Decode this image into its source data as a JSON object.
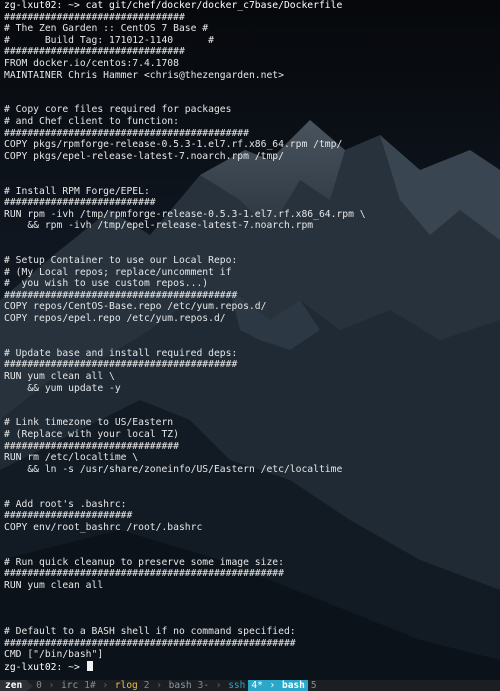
{
  "terminal": {
    "lines": [
      "zg-lxut02: ~> cat git/chef/docker/docker_c7base/Dockerfile",
      "###############################",
      "# The Zen Garden :: CentOS 7 Base #",
      "#      Build Tag: 171012-1140      #",
      "###############################",
      "FROM docker.io/centos:7.4.1708",
      "MAINTAINER Chris Hammer <chris@thezengarden.net>",
      "",
      "",
      "# Copy core files required for packages",
      "# and Chef client to function:",
      "##########################################",
      "COPY pkgs/rpmforge-release-0.5.3-1.el7.rf.x86_64.rpm /tmp/",
      "COPY pkgs/epel-release-latest-7.noarch.rpm /tmp/",
      "",
      "",
      "# Install RPM Forge/EPEL:",
      "##########################",
      "RUN rpm -ivh /tmp/rpmforge-release-0.5.3-1.el7.rf.x86_64.rpm \\",
      "    && rpm -ivh /tmp/epel-release-latest-7.noarch.rpm",
      "",
      "",
      "# Setup Container to use our Local Repo:",
      "# (My Local repos; replace/uncomment if",
      "#  you wish to use custom repos...)",
      "########################################",
      "COPY repos/CentOS-Base.repo /etc/yum.repos.d/",
      "COPY repos/epel.repo /etc/yum.repos.d/",
      "",
      "",
      "# Update base and install required deps:",
      "########################################",
      "RUN yum clean all \\",
      "    && yum update -y",
      "",
      "",
      "# Link timezone to US/Eastern",
      "# (Replace with your local TZ)",
      "##############################",
      "RUN rm /etc/localtime \\",
      "    && ln -s /usr/share/zoneinfo/US/Eastern /etc/localtime",
      "",
      "",
      "# Add root's .bashrc:",
      "######################",
      "COPY env/root_bashrc /root/.bashrc",
      "",
      "",
      "# Run quick cleanup to preserve some image size:",
      "################################################",
      "RUN yum clean all",
      "",
      "",
      "",
      "# Default to a BASH shell if no command specified:",
      "##################################################",
      "CMD [\"/bin/bash\"]",
      "zg-lxut02: ~> "
    ]
  },
  "status_bar": {
    "session": "zen",
    "windows": [
      {
        "index": "0",
        "name": "irc",
        "flag": ""
      },
      {
        "index": "1#",
        "name": "rlog",
        "flag": ""
      },
      {
        "index": "2",
        "name": "bash",
        "flag": ""
      },
      {
        "index": "3-",
        "name": "ssh",
        "flag": ""
      },
      {
        "index": "4*",
        "name": "bash",
        "flag": ""
      },
      {
        "index": "5",
        "name": "",
        "flag": ""
      }
    ]
  },
  "colors": {
    "terminal_text": "#e6e6e6",
    "status_bar_bg": "#1b1f24",
    "session_bg": "#2c3138",
    "active_window_bg": "#2aa7c9",
    "activity_window": "#f0c040"
  },
  "icons": {
    "background": "mountain-landscape-wallpaper",
    "separator": "powerline-arrow-icon"
  }
}
